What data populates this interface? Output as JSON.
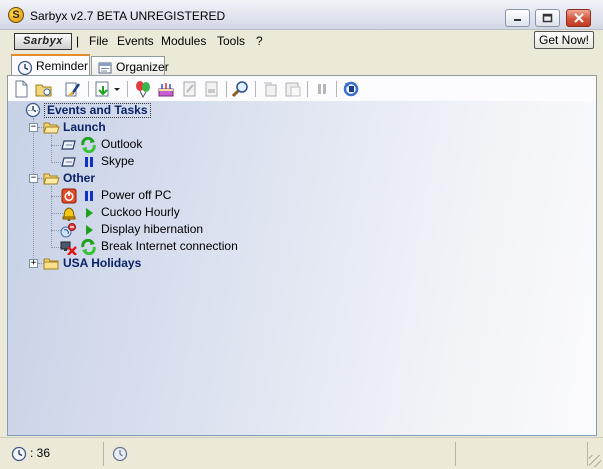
{
  "window": {
    "title": "Sarbyx v2.7 BETA UNREGISTERED",
    "app_icon_letter": "S"
  },
  "menubar": {
    "logo": "Sarbyx",
    "separator": "|",
    "items": [
      "File",
      "Events",
      "Modules",
      "Tools",
      "?"
    ],
    "get_now": "Get Now!"
  },
  "tabs": [
    {
      "label": "Reminder",
      "active": true
    },
    {
      "label": "Organizer",
      "active": false
    }
  ],
  "toolbar": {
    "buttons": [
      "new-icon",
      "open-folder-icon",
      "edit-icon",
      "import-icon",
      "dropdown-arrow-icon",
      "balloons-icon",
      "cake-icon",
      "document-icon",
      "disabled-doc-icon",
      "search-icon",
      "copy-icon",
      "paste-icon",
      "pause-icon",
      "refresh-icon"
    ]
  },
  "tree": {
    "root": {
      "label": "Events and Tasks"
    },
    "groups": [
      {
        "label": "Launch",
        "expanded": true,
        "items": [
          {
            "label": "Outlook",
            "type": "app",
            "state": "recurring"
          },
          {
            "label": "Skype",
            "type": "app",
            "state": "paused"
          }
        ]
      },
      {
        "label": "Other",
        "expanded": true,
        "items": [
          {
            "label": "Power off PC",
            "type": "power",
            "state": "paused"
          },
          {
            "label": "Cuckoo Hourly",
            "type": "bell",
            "state": "running"
          },
          {
            "label": "Display hibernation",
            "type": "display",
            "state": "running"
          },
          {
            "label": "Break Internet connection",
            "type": "network",
            "state": "recurring"
          }
        ]
      },
      {
        "label": "USA Holidays",
        "expanded": false,
        "items": []
      }
    ]
  },
  "statusbar": {
    "count_text": ": 36"
  },
  "colors": {
    "tree_bold": "#0a2266",
    "tab_accent": "#e68b2c",
    "play_green": "#1ca21c",
    "pause_blue": "#1030c8"
  }
}
